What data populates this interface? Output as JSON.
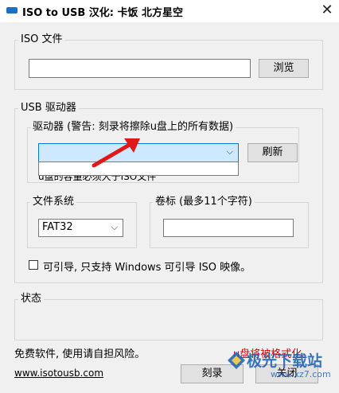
{
  "window": {
    "title": "ISO to USB  汉化: 卡饭 北方星空",
    "close_glyph": "✕"
  },
  "iso_group": {
    "legend": "ISO 文件",
    "path_value": "",
    "browse_label": "浏览"
  },
  "usb_group": {
    "legend": "USB 驱动器",
    "drive_legend": "驱动器 (警告: 刻录将擦除u盘上的所有数据)",
    "drive_selected": "",
    "dropdown_arrow": "⌵",
    "refresh_label": "刷新",
    "hidden_note": "u盘的容量必须大于ISO文件",
    "filesystem_legend": "文件系统",
    "filesystem_value": "FAT32",
    "volume_legend": "卷标 (最多11个字符)",
    "volume_value": "",
    "bootable_label": "可引导, 只支持 Windows 可引导 ISO 映像。",
    "bootable_checked": false
  },
  "status_group": {
    "legend": "状态",
    "text": ""
  },
  "footer": {
    "disclaimer": "免费软件, 使用请自担风险。",
    "format_warning": "u盘将被格式化。",
    "website": "www.isotousb.com",
    "burn_label": "刻录",
    "close_label": "关闭"
  },
  "overlay": {
    "watermark": "极光下载站",
    "watermark_url": "www.xz7.com"
  },
  "colors": {
    "accent_blue": "#1e6fbf",
    "warning_red": "#d40000",
    "annotation_arrow": "#e01818",
    "dropdown_highlight": "#cde8ff",
    "watermark_blue": "#1a5fb0"
  }
}
